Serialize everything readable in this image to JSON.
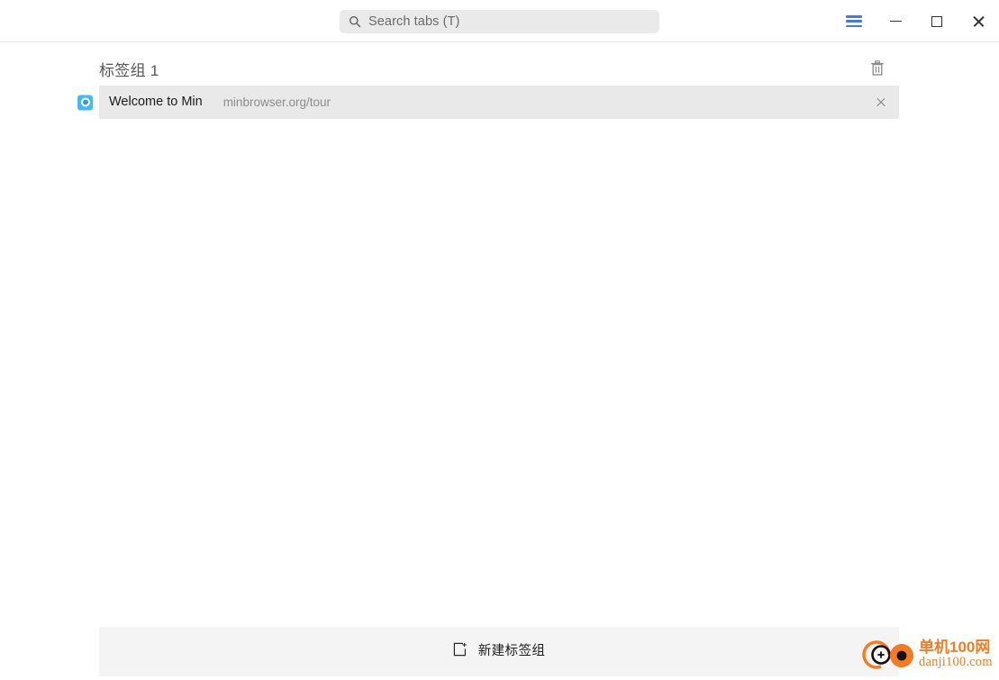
{
  "window": {
    "background": "#ffffff",
    "accent_blue": "#4a76e0"
  },
  "titlebar": {
    "search": {
      "icon": "search-icon",
      "placeholder": "Search tabs (T)",
      "value": ""
    },
    "controls": [
      {
        "name": "menu-button",
        "icon": "hamburger-menu-icon",
        "label": ""
      },
      {
        "name": "minimize-button",
        "icon": "minimize-icon",
        "label": ""
      },
      {
        "name": "maximize-button",
        "icon": "maximize-icon",
        "label": ""
      },
      {
        "name": "close-window-button",
        "icon": "close-icon",
        "label": ""
      }
    ]
  },
  "task": {
    "title": "标签组 1",
    "delete_icon": "trash-icon",
    "tabs": [
      {
        "favicon": "min-browser-favicon",
        "title": "Welcome to Min",
        "url": "minbrowser.org/tour",
        "close_icon": "close-icon",
        "selected": true
      }
    ]
  },
  "add_task": {
    "icon": "new-frame-plus-icon",
    "label": "新建标签组"
  },
  "watermark": {
    "line1": "单机100网",
    "line2": "danji100.com",
    "color": "#f47b20"
  }
}
